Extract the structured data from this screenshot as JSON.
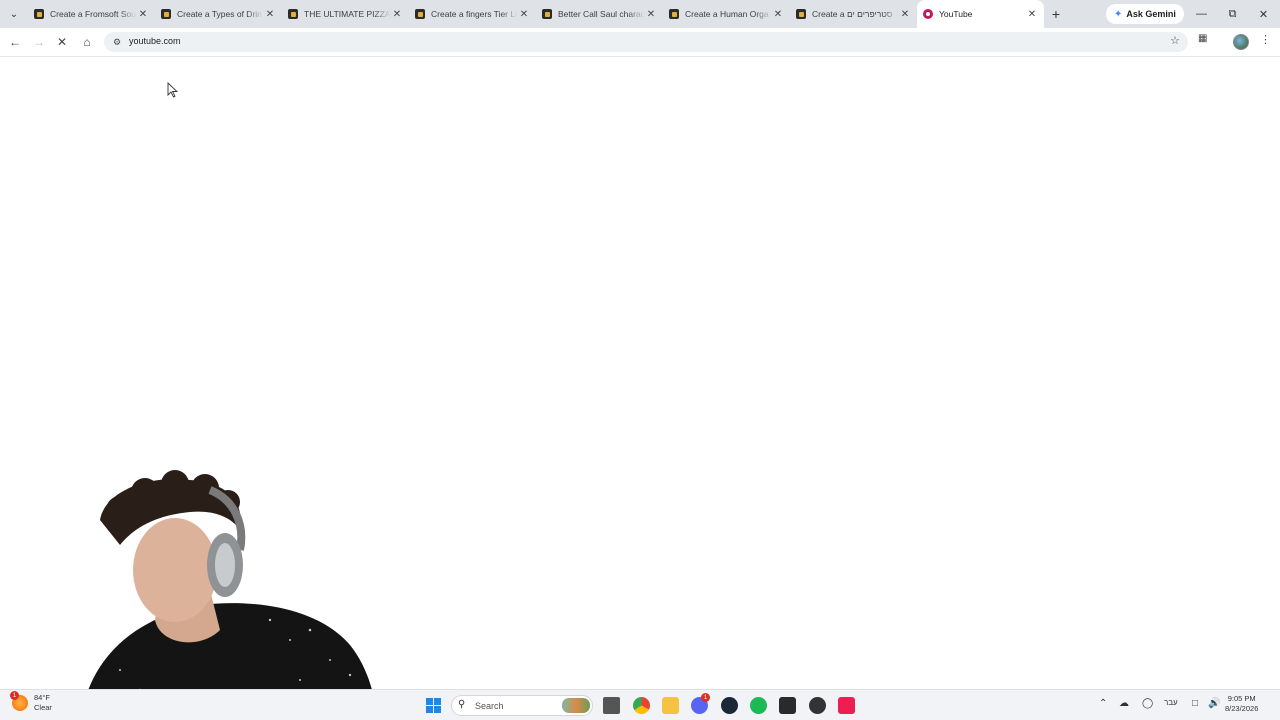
{
  "browser": {
    "tabs": [
      {
        "title": "Create a Fromsoft Sou",
        "active": false
      },
      {
        "title": "Create a Types of Drin",
        "active": false
      },
      {
        "title": "THE ULTIMATE PIZZA T",
        "active": false
      },
      {
        "title": "Create a fingers Tier Li",
        "active": false
      },
      {
        "title": "Better Call Saul charac",
        "active": false
      },
      {
        "title": "Create a Human Orga",
        "active": false
      },
      {
        "title": "Create a סטריפרים ים",
        "active": false
      },
      {
        "title": "YouTube",
        "active": true
      }
    ],
    "new_tab_label": "+",
    "ask_gemini_label": "Ask Gemini",
    "url": "youtube.com"
  },
  "taskbar": {
    "weather": {
      "temp": "84°F",
      "condition": "Clear",
      "badge": "1"
    },
    "search_label": "Search",
    "discord_badge": "1",
    "language": "עבר",
    "time": "9:05 PM",
    "date": "8/23/2026"
  }
}
